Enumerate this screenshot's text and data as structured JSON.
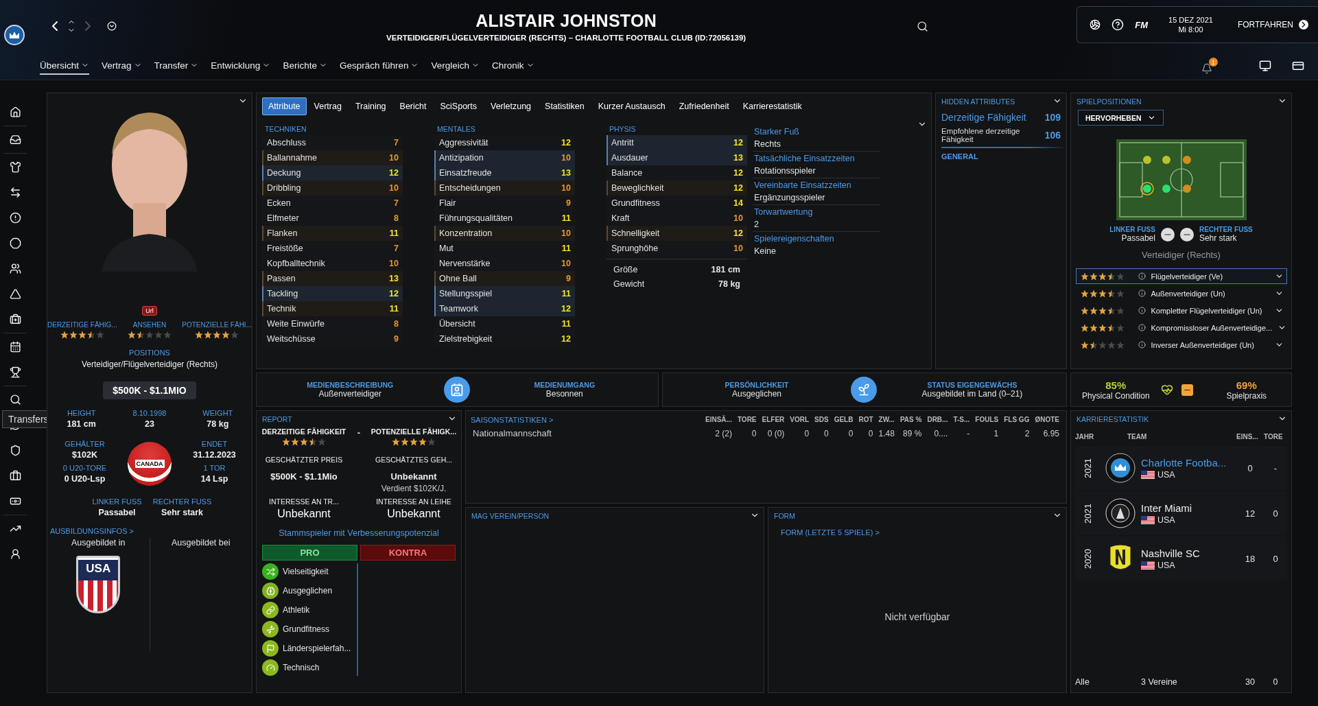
{
  "header": {
    "title": "ALISTAIR JOHNSTON",
    "subtitle": "VERTEIDIGER/FLÜGELVERTEIDIGER (RECHTS) – CHARLOTTE FOOTBALL CLUB (ID:72056139)",
    "logo_text": "FM",
    "date": "15 DEZ 2021",
    "time": "Mi 8:00",
    "continue": "FORTFAHREN",
    "notification_count": "1"
  },
  "nav": [
    {
      "label": "Übersicht",
      "selected": true
    },
    {
      "label": "Vertrag",
      "selected": false
    },
    {
      "label": "Transfer",
      "selected": false
    },
    {
      "label": "Entwicklung",
      "selected": false
    },
    {
      "label": "Berichte",
      "selected": false
    },
    {
      "label": "Gespräch führen",
      "selected": false
    },
    {
      "label": "Vergleich",
      "selected": false
    },
    {
      "label": "Chronik",
      "selected": false
    }
  ],
  "tooltip": "Transfers",
  "profile": {
    "badge": "Url",
    "ratings": [
      {
        "label": "DERZEITIGE FÄHIG...",
        "stars": 3.5
      },
      {
        "label": "ANSEHEN",
        "stars": 1.5
      },
      {
        "label": "POTENZIELLE FÄHI...",
        "stars": 4
      }
    ],
    "positions_label": "POSITIONS",
    "positions": "Verteidiger/Flügelverteidiger (Rechts)",
    "value": "$500K - $1.1MIO",
    "facts": [
      {
        "label": "HEIGHT",
        "value": "181 cm"
      },
      {
        "label": "8.10.1998",
        "value": "23"
      },
      {
        "label": "WEIGHT",
        "value": "78 kg"
      }
    ],
    "contract": [
      {
        "label": "GEHÄLTER",
        "value": "$102K"
      },
      {
        "label": "ENDET",
        "value": "31.12.2023"
      },
      {
        "label": "0 U20-TORE",
        "value": "0 U20-Lsp"
      },
      {
        "label": "1 TOR",
        "value": "14 Lsp"
      }
    ],
    "national_team": "CANADA",
    "feet": [
      {
        "label": "LINKER FUSS",
        "value": "Passabel"
      },
      {
        "label": "RECHTER FUSS",
        "value": "Sehr stark"
      }
    ],
    "training_title": "AUSBILDUNGSINFOS >",
    "trained_in": "Ausgebildet in",
    "trained_at": "Ausgebildet bei",
    "trained_in_crest": "USA"
  },
  "attributes": {
    "tabs": [
      {
        "label": "Attribute",
        "selected": true
      },
      {
        "label": "Vertrag",
        "selected": false
      },
      {
        "label": "Training",
        "selected": false
      },
      {
        "label": "Bericht",
        "selected": false
      },
      {
        "label": "SciSports",
        "selected": false
      },
      {
        "label": "Verletzung",
        "selected": false
      },
      {
        "label": "Statistiken",
        "selected": false
      },
      {
        "label": "Kurzer Austausch",
        "selected": false
      },
      {
        "label": "Zufriedenheit",
        "selected": false
      },
      {
        "label": "Karrierestatistik",
        "selected": false
      }
    ],
    "groups": [
      {
        "title": "TECHNIKEN",
        "rows": [
          {
            "name": "Abschluss",
            "value": "7",
            "primary": false,
            "secondary": false
          },
          {
            "name": "Ballannahme",
            "value": "10",
            "primary": false,
            "secondary": true
          },
          {
            "name": "Deckung",
            "value": "12",
            "primary": true,
            "secondary": false
          },
          {
            "name": "Dribbling",
            "value": "10",
            "primary": false,
            "secondary": true
          },
          {
            "name": "Ecken",
            "value": "7",
            "primary": false,
            "secondary": false
          },
          {
            "name": "Elfmeter",
            "value": "8",
            "primary": false,
            "secondary": false
          },
          {
            "name": "Flanken",
            "value": "11",
            "primary": false,
            "secondary": true
          },
          {
            "name": "Freistöße",
            "value": "7",
            "primary": false,
            "secondary": false
          },
          {
            "name": "Kopfballtechnik",
            "value": "10",
            "primary": false,
            "secondary": false
          },
          {
            "name": "Passen",
            "value": "13",
            "primary": false,
            "secondary": true
          },
          {
            "name": "Tackling",
            "value": "12",
            "primary": true,
            "secondary": false
          },
          {
            "name": "Technik",
            "value": "11",
            "primary": false,
            "secondary": true
          },
          {
            "name": "Weite Einwürfe",
            "value": "8",
            "primary": false,
            "secondary": false
          },
          {
            "name": "Weitschüsse",
            "value": "9",
            "primary": false,
            "secondary": false
          }
        ]
      },
      {
        "title": "MENTALES",
        "rows": [
          {
            "name": "Aggressivität",
            "value": "12",
            "primary": false,
            "secondary": false
          },
          {
            "name": "Antizipation",
            "value": "10",
            "primary": true,
            "secondary": false
          },
          {
            "name": "Einsatzfreude",
            "value": "13",
            "primary": true,
            "secondary": false
          },
          {
            "name": "Entscheidungen",
            "value": "10",
            "primary": false,
            "secondary": true
          },
          {
            "name": "Flair",
            "value": "9",
            "primary": false,
            "secondary": false
          },
          {
            "name": "Führungsqualitäten",
            "value": "11",
            "primary": false,
            "secondary": false
          },
          {
            "name": "Konzentration",
            "value": "10",
            "primary": false,
            "secondary": true
          },
          {
            "name": "Mut",
            "value": "11",
            "primary": false,
            "secondary": false
          },
          {
            "name": "Nervenstärke",
            "value": "10",
            "primary": false,
            "secondary": false
          },
          {
            "name": "Ohne Ball",
            "value": "9",
            "primary": false,
            "secondary": true
          },
          {
            "name": "Stellungsspiel",
            "value": "11",
            "primary": true,
            "secondary": false
          },
          {
            "name": "Teamwork",
            "value": "12",
            "primary": true,
            "secondary": false
          },
          {
            "name": "Übersicht",
            "value": "11",
            "primary": false,
            "secondary": false
          },
          {
            "name": "Zielstrebigkeit",
            "value": "12",
            "primary": false,
            "secondary": false
          }
        ]
      },
      {
        "title": "PHYSIS",
        "rows": [
          {
            "name": "Antritt",
            "value": "12",
            "primary": true,
            "secondary": false
          },
          {
            "name": "Ausdauer",
            "value": "13",
            "primary": true,
            "secondary": false
          },
          {
            "name": "Balance",
            "value": "12",
            "primary": false,
            "secondary": false
          },
          {
            "name": "Beweglichkeit",
            "value": "12",
            "primary": false,
            "secondary": true
          },
          {
            "name": "Grundfitness",
            "value": "14",
            "primary": false,
            "secondary": false
          },
          {
            "name": "Kraft",
            "value": "10",
            "primary": false,
            "secondary": false
          },
          {
            "name": "Schnelligkeit",
            "value": "12",
            "primary": false,
            "secondary": true
          },
          {
            "name": "Sprunghöhe",
            "value": "10",
            "primary": false,
            "secondary": false
          }
        ]
      }
    ],
    "body": [
      {
        "label": "Größe",
        "value": "181 cm"
      },
      {
        "label": "Gewicht",
        "value": "78 kg"
      }
    ],
    "info": [
      {
        "label": "Starker Fuß",
        "value": "Rechts"
      },
      {
        "label": "Tatsächliche Einsatzzeiten",
        "value": "Rotationsspieler"
      },
      {
        "label": "Vereinbarte Einsatzzeiten",
        "value": "Ergänzungsspieler"
      },
      {
        "label": "Torwartwertung",
        "value": "2"
      },
      {
        "label": "Spielereigenschaften",
        "value": "Keine"
      }
    ]
  },
  "hidden": {
    "title": "HIDDEN ATTRIBUTES",
    "rows": [
      {
        "label": "Derzeitige Fähigkeit",
        "value": "109",
        "kind": "main"
      },
      {
        "label": "Empfohlene derzeitige Fähigkeit",
        "value": "106",
        "kind": "sub"
      }
    ],
    "section": "GENERAL"
  },
  "positions": {
    "title": "SPIELPOSITIONEN",
    "dropdown": "HERVORHEBEN",
    "feet": [
      {
        "label": "LINKER FUSS",
        "value": "Passabel"
      },
      {
        "label": "RECHTER FUSS",
        "value": "Sehr stark"
      }
    ],
    "role": "Verteidiger (Rechts)",
    "roles": [
      {
        "name": "Flügelverteidiger (Ve)",
        "stars": 3.5,
        "selected": true
      },
      {
        "name": "Außenverteidiger (Un)",
        "stars": 3.5,
        "selected": false
      },
      {
        "name": "Kompletter Flügelverteidiger (Un)",
        "stars": 3.5,
        "selected": false
      },
      {
        "name": "Kompromissloser Außenverteidige...",
        "stars": 3.5,
        "selected": false
      },
      {
        "name": "Inverser Außenverteidiger (Un)",
        "stars": 1.5,
        "selected": false
      }
    ]
  },
  "media": [
    {
      "label": "MEDIENBESCHREIBUNG",
      "value": "Außenverteidiger"
    },
    {
      "label": "MEDIENUMGANG",
      "value": "Besonnen"
    }
  ],
  "personality": [
    {
      "label": "PERSÖNLICHKEIT",
      "value": "Ausgeglichen"
    },
    {
      "label": "STATUS EIGENGEWÄCHS",
      "value": "Ausgebildet im Land (0–21)"
    }
  ],
  "condition": [
    {
      "value": "85%",
      "label": "Physical Condition",
      "color": "#b5d334"
    },
    {
      "value": "69%",
      "label": "Spielpraxis",
      "color": "#f0a33a"
    }
  ],
  "report": {
    "title": "REPORT",
    "current": {
      "label": "DERZEITIGE FÄHIGKEIT",
      "stars": 3.5
    },
    "separator": "-",
    "potential": {
      "label": "POTENZIELLE FÄHIGK...",
      "stars": 4
    },
    "price_label": "GESCHÄTZTER PREIS",
    "price": "$500K - $1.1Mio",
    "wage_label": "GESCHÄTZTES GEH...",
    "wage": "Unbekannt",
    "wage_note": "Verdient $102K/J.",
    "interest": [
      {
        "label": "INTERESSE AN TR...",
        "value": "Unbekannt"
      },
      {
        "label": "INTERESSE AN LEIHE",
        "value": "Unbekannt"
      }
    ],
    "summary": "Stammspieler mit Verbesserungspotenzial",
    "pro": "PRO",
    "contra": "KONTRA",
    "traits": [
      "Vielseitigkeit",
      "Ausgeglichen",
      "Athletik",
      "Grundfitness",
      "Länderspielerfah...",
      "Technisch"
    ]
  },
  "season": {
    "title": "SAISONSTATISTIKEN >",
    "columns": [
      "EINSÄ...",
      "TORE",
      "ELFER",
      "VORL",
      "SDS",
      "GELB",
      "ROT",
      "ZW...",
      "PAS %",
      "DRB...",
      "T-S...",
      "FOULS",
      "FLS GG",
      "ØNOTE"
    ],
    "rows": [
      {
        "label": "Nationalmannschaft",
        "cells": [
          "2 (2)",
          "0",
          "0 (0)",
          "0",
          "0",
          "0",
          "0",
          "1.48",
          "89 %",
          "0....",
          "-",
          "1",
          "2",
          "6.95"
        ]
      }
    ]
  },
  "likes": {
    "title": "MAG VEREIN/PERSON"
  },
  "form": {
    "title": "FORM",
    "link": "FORM (LETZTE 5 SPIELE) >",
    "empty": "Nicht verfügbar"
  },
  "career": {
    "title": "KARRIERESTATISTIK",
    "columns": [
      "JAHR",
      "TEAM",
      "EINS...",
      "TORE"
    ],
    "rows": [
      {
        "year": "2021",
        "team": "Charlotte Footba...",
        "country": "USA",
        "apps": "0",
        "goals": "-",
        "current": true,
        "kind": "crown"
      },
      {
        "year": "2021",
        "team": "Inter Miami",
        "country": "USA",
        "apps": "12",
        "goals": "0",
        "current": false,
        "kind": "ring"
      },
      {
        "year": "2020",
        "team": "Nashville SC",
        "country": "USA",
        "apps": "18",
        "goals": "0",
        "current": false,
        "kind": "shield"
      }
    ],
    "footer": [
      "Alle",
      "3 Vereine",
      "30",
      "0"
    ]
  }
}
